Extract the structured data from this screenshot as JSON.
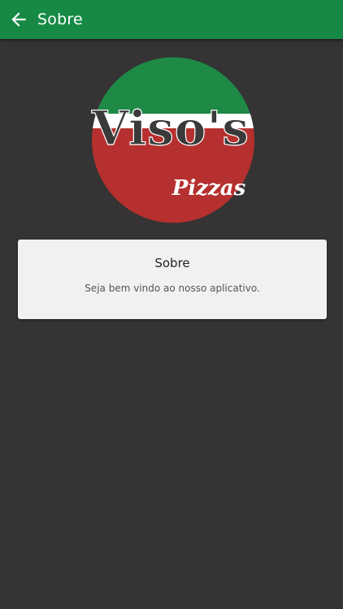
{
  "app_bar": {
    "title": "Sobre",
    "back_icon": "arrow-left-icon",
    "color": "#168a45"
  },
  "logo": {
    "name_text": "Viso's",
    "tagline_text": "Pizzas",
    "colors": {
      "green": "#1e8a46",
      "white": "#ffffff",
      "red": "#b5302f",
      "lettering": "#3a3a3a"
    }
  },
  "about_card": {
    "title": "Sobre",
    "text": "Seja bem vindo ao nosso aplicativo."
  },
  "theme": {
    "background": "#353334",
    "card_background": "#f1f1f1"
  }
}
